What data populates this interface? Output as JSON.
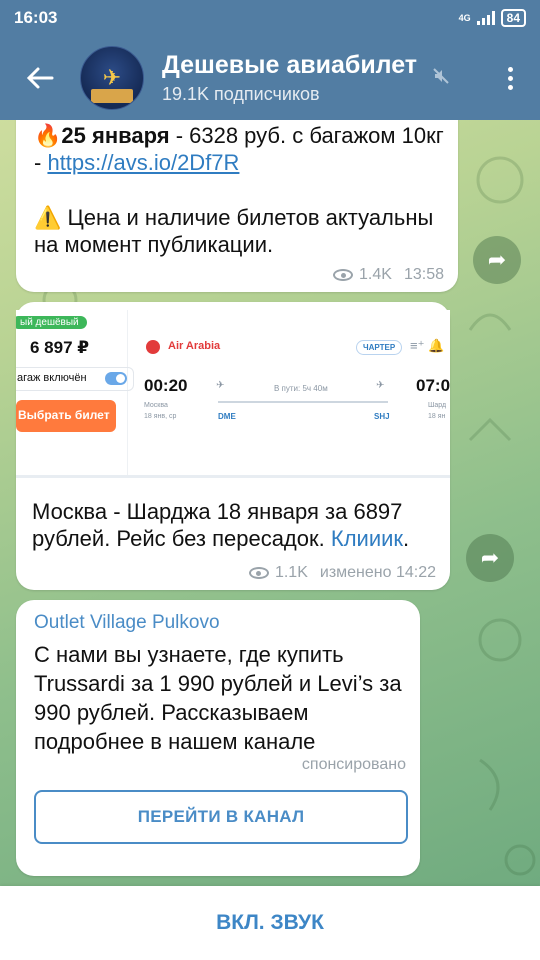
{
  "status_bar": {
    "time": "16:03",
    "network": "4G",
    "battery": "84"
  },
  "header": {
    "title": "Дешевые авиабилет",
    "subtitle": "19.1K подписчиков",
    "avatar_text": "Дешевые авиабилеты"
  },
  "messages": [
    {
      "lead_emoji": "🔥",
      "bold": "25 января",
      "text": " - 6328 руб. с багажом 10кг - ",
      "link": "https://avs.io/2Df7R",
      "warning_emoji": "⚠️",
      "warning": " Цена и наличие билетов актуальны на момент публикации.",
      "views": "1.4K",
      "time": "13:58"
    },
    {
      "preview": {
        "badge": "ый дешёвый",
        "price": "6 897 ₽",
        "baggage": "агаж включён",
        "buy": "Выбрать билет",
        "airline": "Air Arabia",
        "charter": "ЧАРТЕР",
        "dep_time": "00:20",
        "arr_time": "07:0",
        "duration": "В пути: 5ч 40м",
        "dep_city": "Москва",
        "dep_date": "18 янв, ср",
        "arr_city": "Шард",
        "arr_date": "18 ян",
        "dep_code": "DME",
        "arr_code": "SHJ"
      },
      "text": "Москва - Шарджа 18 января за 6897 рублей. Рейс без пересадок.",
      "link": "Клииик",
      "views": "1.1K",
      "time": "изменено 14:22"
    }
  ],
  "sponsored": {
    "title": "Outlet Village Pulkovo",
    "text": "С нами вы узнаете, где купить Trussardi за 1 990 рублей и Levi’s за 990 рублей. Рассказываем подробнее в нашем канале",
    "label": "спонсировано",
    "button": "ПЕРЕЙТИ В КАНАЛ"
  },
  "bottom_bar": {
    "label": "ВКЛ. ЗВУК"
  },
  "colors": {
    "header": "#527da3",
    "accent": "#4a8cc6",
    "link": "#2f7cc1"
  },
  "icons": [
    "back-arrow-icon",
    "mute-icon",
    "more-vert-icon",
    "eye-icon",
    "share-icon"
  ]
}
